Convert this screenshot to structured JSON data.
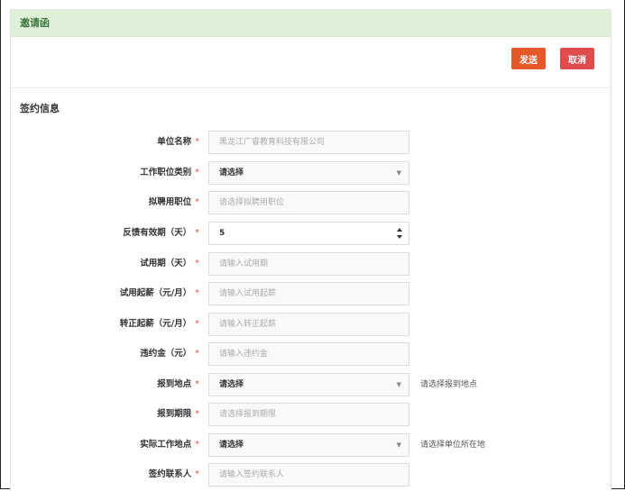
{
  "panel": {
    "title": "邀请函"
  },
  "toolbar": {
    "send_label": "发送",
    "cancel_label": "取消"
  },
  "section": {
    "title": "签约信息"
  },
  "form": {
    "rows": [
      {
        "label": "单位名称",
        "value": "黑龙江广睿教育科技有限公司",
        "type": "readonly"
      },
      {
        "label": "工作职位类别",
        "value": "请选择",
        "type": "select"
      },
      {
        "label": "拟聘用职位",
        "placeholder": "请选择拟聘用职位",
        "type": "input"
      },
      {
        "label": "反馈有效期（天）",
        "value": "5",
        "type": "number"
      },
      {
        "label": "试用期（天）",
        "placeholder": "请输入试用期",
        "type": "input"
      },
      {
        "label": "试用起薪（元/月）",
        "placeholder": "请输入试用起薪",
        "type": "input"
      },
      {
        "label": "转正起薪（元/月）",
        "placeholder": "请输入转正起薪",
        "type": "input"
      },
      {
        "label": "违约金（元）",
        "placeholder": "请输入违约金",
        "type": "input"
      },
      {
        "label": "报到地点",
        "value": "请选择",
        "type": "select",
        "hint": "请选择报到地点"
      },
      {
        "label": "报到期限",
        "placeholder": "请选择报到期限",
        "type": "input"
      },
      {
        "label": "实际工作地点",
        "value": "请选择",
        "type": "select",
        "hint": "请选择单位所在地"
      },
      {
        "label": "签约联系人",
        "placeholder": "请输入签约联系人",
        "type": "input"
      }
    ],
    "required_mark": "*"
  },
  "colors": {
    "header_bg": "#dff0d8",
    "header_text": "#3c763d",
    "send_button": "#e4582a",
    "cancel_button": "#e04b4b",
    "required": "#e05050"
  }
}
